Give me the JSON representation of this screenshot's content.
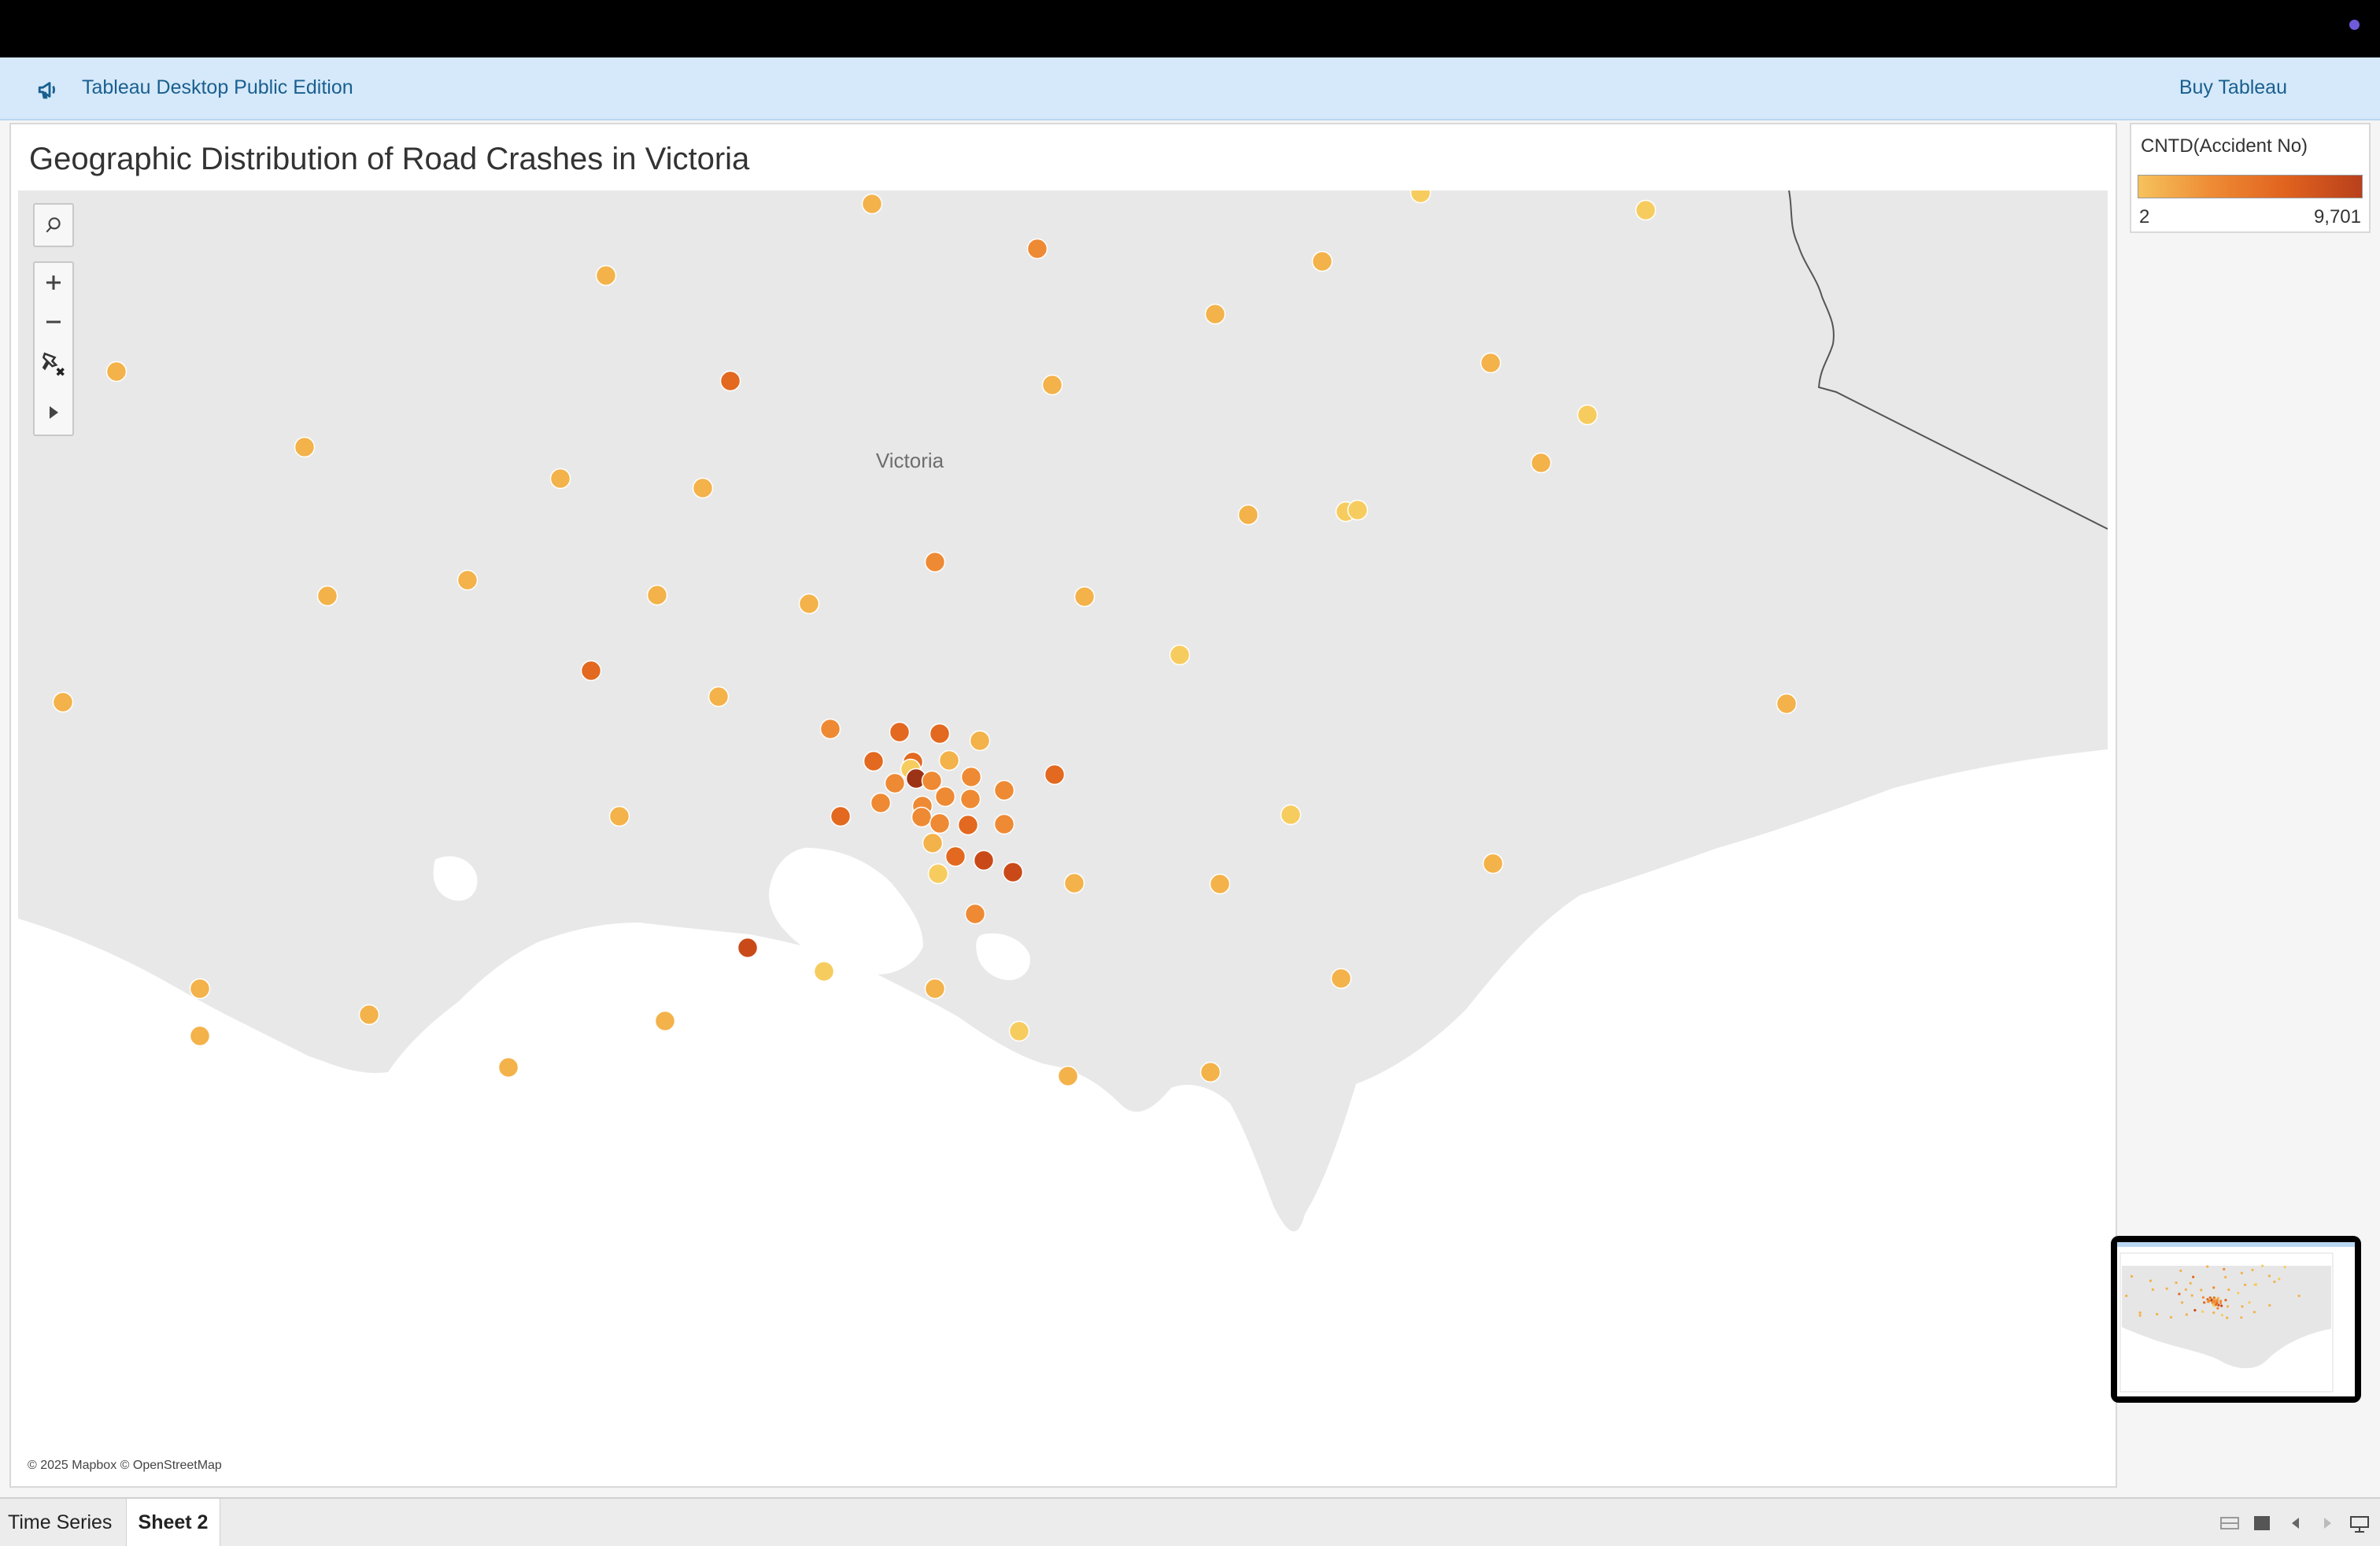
{
  "banner": {
    "title": "Tableau Desktop Public Edition",
    "buy_label": "Buy Tableau",
    "icon": "megaphone-icon"
  },
  "sheet": {
    "title": "Geographic Distribution of Road Crashes in Victoria"
  },
  "map": {
    "region_label": "Victoria",
    "attribution": "© 2025 Mapbox © OpenStreetMap",
    "tools": [
      "search-icon",
      "zoom-in-icon",
      "zoom-out-icon",
      "clear-pin-icon",
      "expand-icon"
    ]
  },
  "legend": {
    "title": "CNTD(Accident No)",
    "min_label": "2",
    "max_label": "9,701",
    "colors": [
      "#f6c25c",
      "#ee8a34",
      "#e0621e",
      "#b8401c"
    ]
  },
  "tabs": [
    {
      "label": "Time Series",
      "active": false
    },
    {
      "label": "Sheet 2",
      "active": true
    }
  ],
  "colors": {
    "topbar": "#000000",
    "banner": "#d5e9fa",
    "land": "#e9e9e9",
    "water": "#ffffff"
  }
}
